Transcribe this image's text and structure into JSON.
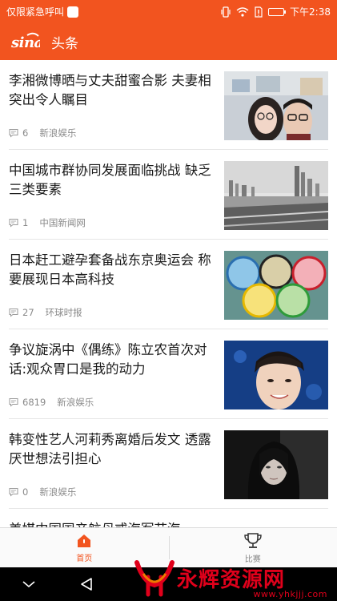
{
  "status_bar": {
    "left_text": "仅限紧急呼叫",
    "time": "下午2:38",
    "icons": [
      "vibrate-icon",
      "wifi-icon",
      "sim-alert-icon",
      "battery-icon"
    ],
    "battery_level": 0.8
  },
  "header": {
    "logo_text": "sina",
    "title": "头条",
    "background_color": "#f2541f"
  },
  "news": [
    {
      "title": "李湘微博晒与丈夫甜蜜合影 夫妻相突出令人瞩目",
      "comments": "6",
      "source": "新浪娱乐",
      "thumb": "couple-selfie"
    },
    {
      "title": "中国城市群协同发展面临挑战 缺乏三类要素",
      "comments": "1",
      "source": "中国新闻网",
      "thumb": "city-skyline"
    },
    {
      "title": "日本赶工避孕套备战东京奥运会 称要展现日本高科技",
      "comments": "27",
      "source": "环球时报",
      "thumb": "olympic-rings"
    },
    {
      "title": "争议旋涡中《偶练》陈立农首次对话:观众胃口是我的动力",
      "comments": "6819",
      "source": "新浪娱乐",
      "thumb": "young-man-portrait"
    },
    {
      "title": "韩变性艺人河莉秀离婚后发文 透露厌世想法引担心",
      "comments": "0",
      "source": "新浪娱乐",
      "thumb": "woman-portrait"
    },
    {
      "title": "美媒中国国产航母或海军节海",
      "comments": "",
      "source": "",
      "thumb": ""
    }
  ],
  "tabs": [
    {
      "label": "首页",
      "icon": "home-icon",
      "active": true
    },
    {
      "label": "比赛",
      "icon": "trophy-icon",
      "active": false
    }
  ],
  "navbar": {
    "icons": [
      "chevron-down-icon",
      "back-triangle-icon"
    ]
  },
  "watermark": {
    "text": "永辉资源网",
    "url": "www.yhkjjj.com"
  }
}
